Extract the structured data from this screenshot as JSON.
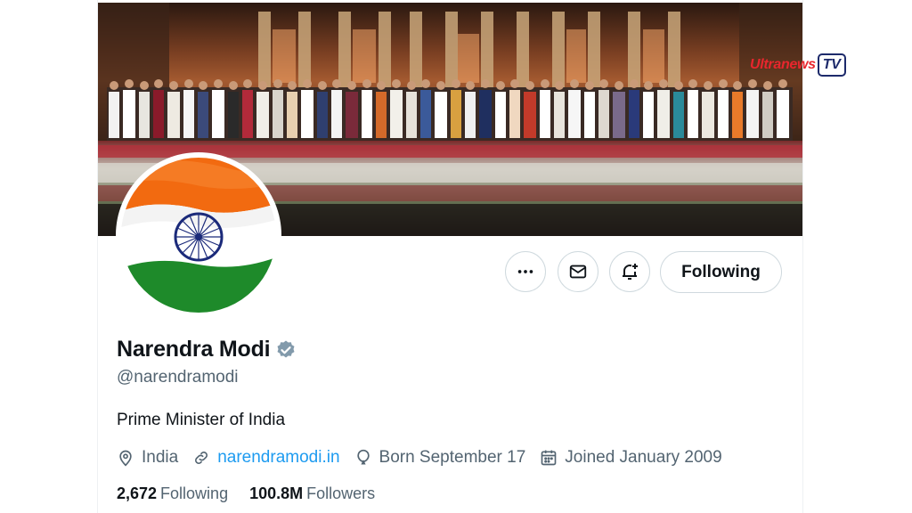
{
  "watermark": {
    "text": "Ultranews",
    "box": "TV"
  },
  "profile": {
    "display_name": "Narendra Modi",
    "handle": "@narendramodi",
    "bio": "Prime Minister of India",
    "location": "India",
    "website": "narendramodi.in",
    "birthday": "Born September 17",
    "joined": "Joined January 2009",
    "following_count": "2,672",
    "following_label": "Following",
    "followers_count": "100.8M",
    "followers_label": "Followers",
    "verified": true
  },
  "actions": {
    "more_icon": "more-icon",
    "message_icon": "mail-icon",
    "notify_icon": "bell-plus-icon",
    "follow_label": "Following"
  },
  "colors": {
    "link": "#1d9bf0",
    "secondary_text": "#536471",
    "verified_badge": "#829aab",
    "saffron": "#f26a10",
    "green": "#1e8a2a",
    "chakra": "#1b2a7a"
  }
}
